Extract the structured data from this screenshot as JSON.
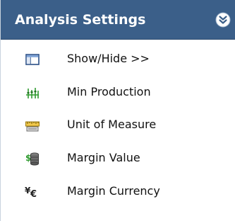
{
  "panel": {
    "title": "Analysis Settings",
    "collapse_icon": "double-chevron-down-icon"
  },
  "menu": {
    "items": [
      {
        "label": "Show/Hide >>",
        "icon": "window-panel-icon"
      },
      {
        "label": "Min Production",
        "icon": "sliders-icon"
      },
      {
        "label": "Unit of Measure",
        "icon": "ruler-icon"
      },
      {
        "label": "Margin Value",
        "icon": "money-stack-icon"
      },
      {
        "label": "Margin Currency",
        "icon": "currency-exchange-icon"
      }
    ]
  },
  "colors": {
    "header_bg": "#3b5f89",
    "header_text": "#ffffff",
    "item_text": "#111111"
  }
}
